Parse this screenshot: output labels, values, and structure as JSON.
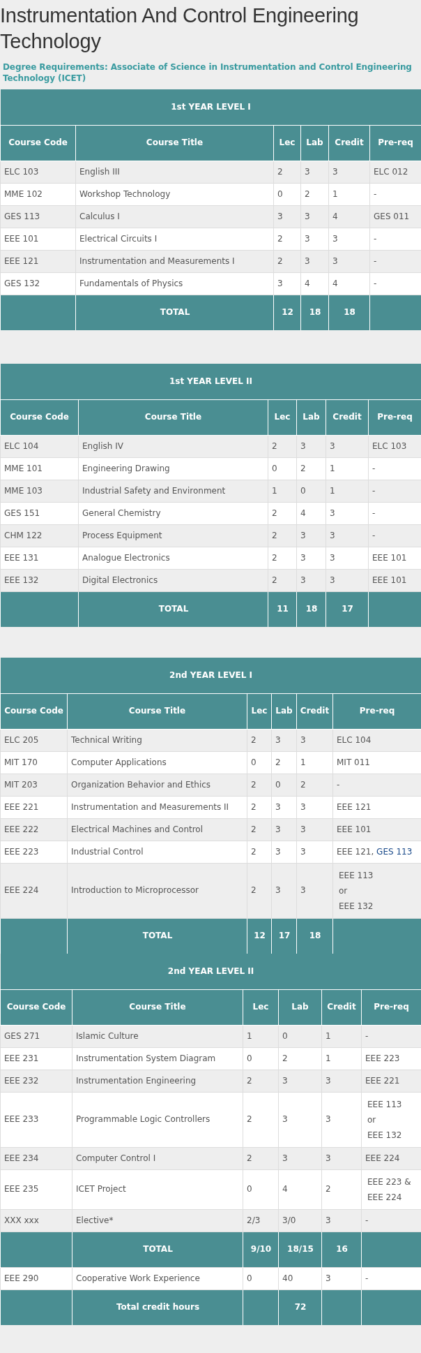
{
  "page": {
    "title": "Instrumentation And Control Engineering Technology",
    "subtitle": "Degree Requirements: Associate of Science in Instrumentation and Control Engineering Technology (ICET)"
  },
  "tables": [
    {
      "title": "1st YEAR LEVEL I",
      "columns": [
        "Course Code",
        "Course Title",
        "Lec",
        "Lab",
        "Credit",
        "Pre-req"
      ],
      "rows": [
        {
          "kind": "course",
          "code": "ELC 103",
          "course_title": "English III",
          "lec": "2",
          "lab": "3",
          "credit": "3",
          "prereq": [
            "ELC 012"
          ]
        },
        {
          "kind": "course",
          "code": "MME 102",
          "course_title": "Workshop Technology",
          "lec": "0",
          "lab": "2",
          "credit": "1",
          "prereq": [
            "-"
          ]
        },
        {
          "kind": "course",
          "code": "GES 113",
          "course_title": "Calculus I",
          "lec": "3",
          "lab": "3",
          "credit": "4",
          "prereq": [
            "GES 011"
          ]
        },
        {
          "kind": "course",
          "code": "EEE 101",
          "course_title": "Electrical Circuits I",
          "lec": "2",
          "lab": "3",
          "credit": "3",
          "prereq": [
            "-"
          ]
        },
        {
          "kind": "course",
          "code": "EEE 121",
          "course_title": "Instrumentation and Measurements I",
          "lec": "2",
          "lab": "3",
          "credit": "3",
          "prereq": [
            "-"
          ]
        },
        {
          "kind": "course",
          "code": "GES 132",
          "course_title": "Fundamentals of Physics",
          "lec": "3",
          "lab": "4",
          "credit": "4",
          "prereq": [
            "-"
          ]
        },
        {
          "kind": "total",
          "label": "TOTAL",
          "lec": "12",
          "lab": "18",
          "credit": "18"
        }
      ]
    },
    {
      "title": "1st YEAR LEVEL II",
      "columns": [
        "Course Code",
        "Course Title",
        "Lec",
        "Lab",
        "Credit",
        "Pre-req"
      ],
      "rows": [
        {
          "kind": "course",
          "code": "ELC 104",
          "course_title": "English IV",
          "lec": "2",
          "lab": "3",
          "credit": "3",
          "prereq": [
            "ELC 103"
          ]
        },
        {
          "kind": "course",
          "code": "MME 101",
          "course_title": "Engineering Drawing",
          "lec": "0",
          "lab": "2",
          "credit": "1",
          "prereq": [
            "-"
          ]
        },
        {
          "kind": "course",
          "code": "MME 103",
          "course_title": "Industrial Safety and Environment",
          "lec": "1",
          "lab": "0",
          "credit": "1",
          "prereq": [
            "-"
          ]
        },
        {
          "kind": "course",
          "code": "GES 151",
          "course_title": "General Chemistry",
          "lec": "2",
          "lab": "4",
          "credit": "3",
          "prereq": [
            "-"
          ]
        },
        {
          "kind": "course",
          "code": "CHM 122",
          "course_title": "Process Equipment",
          "lec": "2",
          "lab": "3",
          "credit": "3",
          "prereq": [
            "-"
          ]
        },
        {
          "kind": "course",
          "code": "EEE 131",
          "course_title": "Analogue Electronics",
          "lec": "2",
          "lab": "3",
          "credit": "3",
          "prereq": [
            "EEE 101"
          ]
        },
        {
          "kind": "course",
          "code": "EEE 132",
          "course_title": "Digital Electronics",
          "lec": "2",
          "lab": "3",
          "credit": "3",
          "prereq": [
            "EEE 101"
          ]
        },
        {
          "kind": "total",
          "label": "TOTAL",
          "lec": "11",
          "lab": "18",
          "credit": "17"
        }
      ]
    },
    {
      "title": "2nd YEAR LEVEL I",
      "columns": [
        "Course Code",
        "Course Title",
        "Lec",
        "Lab",
        "Credit",
        "Pre-req"
      ],
      "rows": [
        {
          "kind": "course",
          "code": "ELC 205",
          "course_title": "Technical Writing",
          "lec": "2",
          "lab": "3",
          "credit": "3",
          "prereq": [
            "ELC 104"
          ]
        },
        {
          "kind": "course",
          "code": "MIT 170",
          "course_title": "Computer Applications",
          "lec": "0",
          "lab": "2",
          "credit": "1",
          "prereq": [
            "MIT 011"
          ]
        },
        {
          "kind": "course",
          "code": "MIT 203",
          "course_title": "Organization Behavior and Ethics",
          "lec": "2",
          "lab": "0",
          "credit": "2",
          "prereq": [
            "-"
          ]
        },
        {
          "kind": "course",
          "code": "EEE 221",
          "course_title": "Instrumentation and Measurements II",
          "lec": "2",
          "lab": "3",
          "credit": "3",
          "prereq": [
            "EEE 121"
          ]
        },
        {
          "kind": "course",
          "code": "EEE 222",
          "course_title": "Electrical Machines and Control",
          "lec": "2",
          "lab": "3",
          "credit": "3",
          "prereq": [
            "EEE 101"
          ]
        },
        {
          "kind": "course",
          "code": "EEE 223",
          "course_title": "Industrial Control",
          "lec": "2",
          "lab": "3",
          "credit": "3",
          "prereq": [
            "EEE 121,"
          ],
          "prereq_link": "GES 113"
        },
        {
          "kind": "course",
          "code": "EEE 224",
          "course_title": "Introduction to Microprocessor",
          "lec": "2",
          "lab": "3",
          "credit": "3",
          "prereq": [
            "EEE 113",
            "or",
            "EEE 132"
          ]
        },
        {
          "kind": "total",
          "label": "TOTAL",
          "lec": "12",
          "lab": "17",
          "credit": "18"
        }
      ]
    },
    {
      "title": "2nd YEAR LEVEL II",
      "columns": [
        "Course Code",
        "Course Title",
        "Lec",
        "Lab",
        "Credit",
        "Pre-req"
      ],
      "rows": [
        {
          "kind": "course",
          "code": "GES 271",
          "course_title": "Islamic Culture",
          "lec": "1",
          "lab": "0",
          "credit": "1",
          "prereq": [
            "-"
          ]
        },
        {
          "kind": "course",
          "code": "EEE 231",
          "course_title": "Instrumentation System Diagram",
          "lec": "0",
          "lab": "2",
          "credit": "1",
          "prereq": [
            "EEE 223"
          ]
        },
        {
          "kind": "course",
          "code": "EEE 232",
          "course_title": "Instrumentation Engineering",
          "lec": "2",
          "lab": "3",
          "credit": "3",
          "prereq": [
            "EEE 221"
          ]
        },
        {
          "kind": "course",
          "code": "EEE 233",
          "course_title": "Programmable Logic Controllers",
          "lec": "2",
          "lab": "3",
          "credit": "3",
          "prereq": [
            "EEE 113",
            "or",
            "EEE 132"
          ]
        },
        {
          "kind": "course",
          "code": "EEE 234",
          "course_title": "Computer Control I",
          "lec": "2",
          "lab": "3",
          "credit": "3",
          "prereq": [
            "EEE 224"
          ]
        },
        {
          "kind": "course",
          "code": "EEE 235",
          "course_title": "ICET Project",
          "lec": "0",
          "lab": "4",
          "credit": "2",
          "prereq": [
            "EEE 223 &",
            "EEE 224"
          ]
        },
        {
          "kind": "course",
          "code": "XXX xxx",
          "course_title": "Elective*",
          "lec": "2/3",
          "lab": "3/0",
          "credit": "3",
          "prereq": [
            "-"
          ]
        },
        {
          "kind": "total",
          "label": "TOTAL",
          "lec": "9/10",
          "lab": "18/15",
          "credit": "16"
        },
        {
          "kind": "course",
          "code": "EEE 290",
          "course_title": "Cooperative Work Experience",
          "lec": "0",
          "lab": "40",
          "credit": "3",
          "prereq": [
            "-"
          ]
        },
        {
          "kind": "total",
          "label": "Total credit hours",
          "lab": "72"
        }
      ]
    }
  ]
}
